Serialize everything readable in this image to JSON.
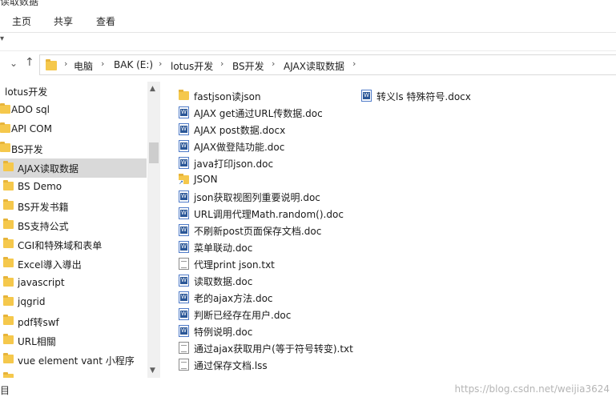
{
  "window": {
    "title_partial": "读取数据"
  },
  "ribbon": {
    "tabs": [
      "主页",
      "共享",
      "查看"
    ]
  },
  "address_bar": {
    "crumbs": [
      "电脑",
      "BAK (E:)",
      "lotus开发",
      "BS开发",
      "AJAX读取数据"
    ]
  },
  "sidebar": {
    "items": [
      {
        "label": "lotus开发",
        "indent": 0,
        "icon": "none"
      },
      {
        "label": "ADO sql",
        "indent": 1,
        "icon": "folder-icon"
      },
      {
        "label": "API COM",
        "indent": 1,
        "icon": "folder-icon"
      },
      {
        "label": "BS开发",
        "indent": 1,
        "icon": "folder-icon"
      },
      {
        "label": "AJAX读取数据",
        "indent": 2,
        "icon": "folder-icon",
        "selected": true
      },
      {
        "label": "BS Demo",
        "indent": 2,
        "icon": "folder-icon"
      },
      {
        "label": "BS开发书籍",
        "indent": 2,
        "icon": "folder-icon"
      },
      {
        "label": "BS支持公式",
        "indent": 2,
        "icon": "folder-icon"
      },
      {
        "label": "CGI和特殊域和表单",
        "indent": 2,
        "icon": "folder-icon"
      },
      {
        "label": "Excel導入導出",
        "indent": 2,
        "icon": "folder-icon"
      },
      {
        "label": "javascript",
        "indent": 2,
        "icon": "folder-icon"
      },
      {
        "label": "jqgrid",
        "indent": 2,
        "icon": "folder-icon"
      },
      {
        "label": "pdf转swf",
        "indent": 2,
        "icon": "folder-icon"
      },
      {
        "label": "URL相關",
        "indent": 2,
        "icon": "folder-icon"
      },
      {
        "label": "vue element vant 小程序",
        "indent": 2,
        "icon": "folder-icon"
      },
      {
        "label": "",
        "indent": 2,
        "icon": "folder-icon"
      }
    ]
  },
  "files": {
    "column1": [
      {
        "name": "fastjson读json",
        "type": "folder"
      },
      {
        "name": "AJAX get通过URL传数据.doc",
        "type": "doc"
      },
      {
        "name": "AJAX post数据.docx",
        "type": "docx"
      },
      {
        "name": "AJAX做登陆功能.doc",
        "type": "doc"
      },
      {
        "name": "java打印json.doc",
        "type": "doc"
      },
      {
        "name": "JSON",
        "type": "shortcut-folder"
      },
      {
        "name": "json获取视图列重要说明.doc",
        "type": "doc"
      },
      {
        "name": "URL调用代理Math.random().doc",
        "type": "doc"
      },
      {
        "name": "不刷新post页面保存文档.doc",
        "type": "doc"
      },
      {
        "name": "菜单联动.doc",
        "type": "doc"
      },
      {
        "name": "代理print json.txt",
        "type": "txt"
      },
      {
        "name": "读取数据.doc",
        "type": "doc"
      },
      {
        "name": "老的ajax方法.doc",
        "type": "doc"
      },
      {
        "name": "判断已经存在用户.doc",
        "type": "doc"
      },
      {
        "name": "特例说明.doc",
        "type": "doc"
      },
      {
        "name": "通过ajax获取用户(等于符号转变).txt",
        "type": "txt"
      },
      {
        "name": "通过保存文档.lss",
        "type": "txt"
      }
    ],
    "column2": [
      {
        "name": "转义ls 特殊符号.docx",
        "type": "docx"
      }
    ]
  },
  "statusbar": {
    "text": "目"
  },
  "watermark": "https://blog.csdn.net/weijia3624"
}
